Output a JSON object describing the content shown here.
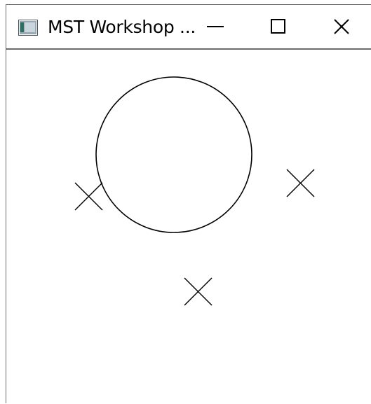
{
  "window": {
    "title": "MST Workshop ...",
    "icon": "app-window-icon",
    "controls": {
      "minimize_icon": "minimize-icon",
      "maximize_icon": "maximize-icon",
      "close_icon": "close-icon"
    }
  },
  "canvas": {
    "background": "#ffffff",
    "stroke_color": "#000000",
    "shapes": [
      {
        "kind": "circle"
      },
      {
        "kind": "cross"
      },
      {
        "kind": "cross"
      },
      {
        "kind": "cross"
      }
    ]
  }
}
